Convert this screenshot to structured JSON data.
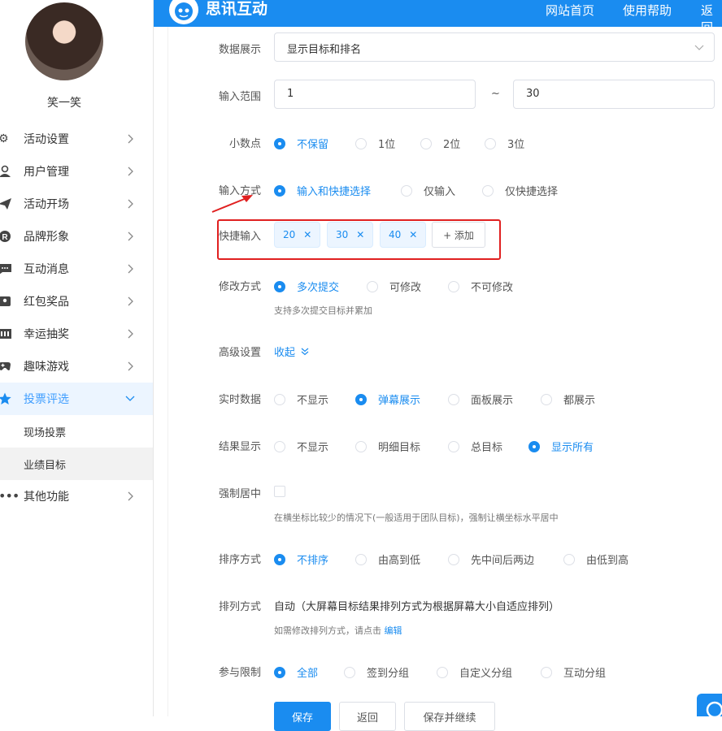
{
  "user": {
    "name": "笑一笑"
  },
  "header": {
    "brand": "思讯互动",
    "nav": [
      "网站首页",
      "使用帮助",
      "返回"
    ]
  },
  "sidebar": {
    "items": [
      {
        "label": "活动设置",
        "icon": "gear-icon"
      },
      {
        "label": "用户管理",
        "icon": "user-icon"
      },
      {
        "label": "活动开场",
        "icon": "paper-plane-icon"
      },
      {
        "label": "品牌形象",
        "icon": "registered-icon"
      },
      {
        "label": "互动消息",
        "icon": "message-icon"
      },
      {
        "label": "红包奖品",
        "icon": "gift-icon"
      },
      {
        "label": "幸运抽奖",
        "icon": "lottery-icon"
      },
      {
        "label": "趣味游戏",
        "icon": "gamepad-icon"
      },
      {
        "label": "投票评选",
        "icon": "star-icon"
      },
      {
        "label": "其他功能",
        "icon": "more-icon"
      }
    ],
    "submenu": [
      "现场投票",
      "业绩目标"
    ]
  },
  "form": {
    "data_display": {
      "label": "数据展示",
      "value": "显示目标和排名"
    },
    "input_range": {
      "label": "输入范围",
      "min": "1",
      "sep": "~",
      "max": "30"
    },
    "decimal": {
      "label": "小数点",
      "options": [
        "不保留",
        "1位",
        "2位",
        "3位"
      ],
      "selected": 0
    },
    "input_mode": {
      "label": "输入方式",
      "options": [
        "输入和快捷选择",
        "仅输入",
        "仅快捷选择"
      ],
      "selected": 0
    },
    "quick_input": {
      "label": "快捷输入",
      "tags": [
        "20",
        "30",
        "40"
      ],
      "add": "+ 添加"
    },
    "modify_mode": {
      "label": "修改方式",
      "options": [
        "多次提交",
        "可修改",
        "不可修改"
      ],
      "selected": 0,
      "hint": "支持多次提交目标并累加"
    },
    "advanced": {
      "label": "高级设置",
      "toggle": "收起"
    },
    "realtime": {
      "label": "实时数据",
      "options": [
        "不显示",
        "弹幕展示",
        "面板展示",
        "都展示"
      ],
      "selected": 1
    },
    "result_display": {
      "label": "结果显示",
      "options": [
        "不显示",
        "明细目标",
        "总目标",
        "显示所有"
      ],
      "selected": 3
    },
    "force_center": {
      "label": "强制居中",
      "hint": "在横坐标比较少的情况下(一般适用于团队目标)，强制让横坐标水平居中"
    },
    "sort_mode": {
      "label": "排序方式",
      "options": [
        "不排序",
        "由高到低",
        "先中间后两边",
        "由低到高"
      ],
      "selected": 0
    },
    "arrange_mode": {
      "label": "排列方式",
      "value": "自动（大屏幕目标结果排列方式为根据屏幕大小自适应排列）",
      "hint": "如需修改排列方式，请点击",
      "edit": "编辑"
    },
    "participation": {
      "label": "参与限制",
      "options": [
        "全部",
        "签到分组",
        "自定义分组",
        "互动分组"
      ],
      "selected": 0
    }
  },
  "actions": {
    "save": "保存",
    "back": "返回",
    "save_continue": "保存并继续"
  },
  "colors": {
    "primary": "#1a8cf0",
    "annotation": "#e02020"
  }
}
